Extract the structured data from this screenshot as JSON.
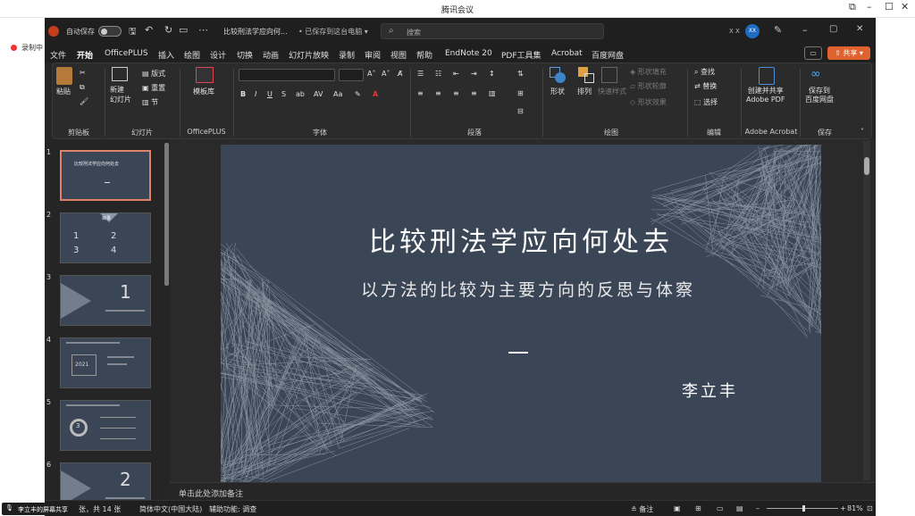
{
  "meeting": {
    "title": "腾讯会议",
    "recording": "录制中",
    "sharing": "李立丰的屏幕共享"
  },
  "ppt": {
    "autosave": "自动保存",
    "filename": "比较刑法学应向何...",
    "saved_state": "• 已保存到这台电脑 ▾",
    "search_placeholder": "搜索",
    "user_short": "X X",
    "avatar": "XX",
    "share_label": "共享",
    "menu": [
      "文件",
      "开始",
      "OfficePLUS",
      "插入",
      "绘图",
      "设计",
      "切换",
      "动画",
      "幻灯片放映",
      "录制",
      "审阅",
      "视图",
      "帮助",
      "EndNote 20",
      "PDF工具集",
      "Acrobat",
      "百度网盘"
    ],
    "active_menu": "开始",
    "ribbon": {
      "groups": [
        "剪贴板",
        "幻灯片",
        "OfficePLUS",
        "字体",
        "段落",
        "绘图",
        "编辑",
        "Adobe Acrobat",
        "保存"
      ],
      "paste": "粘贴",
      "new_slide": "新建\n幻灯片",
      "layout": "版式",
      "reset": "重置",
      "section": "节",
      "template": "模板库",
      "shape": "形状",
      "arrange": "排列",
      "quick_style": "快速样式",
      "shape_fill": "形状填充",
      "shape_outline": "形状轮廓",
      "shape_effect": "形状效果",
      "find": "查找",
      "replace": "替换",
      "select": "选择",
      "create_pdf": "创建并共享\nAdobe PDF",
      "save_baidu": "保存到\n百度网盘"
    },
    "slide": {
      "title": "比较刑法学应向何处去",
      "subtitle": "以方法的比较为主要方向的反思与体察",
      "author": "李立丰"
    },
    "thumbs": [
      {
        "num": "1",
        "label": "比较刑法学应向何处去"
      },
      {
        "num": "2",
        "label": "目录"
      },
      {
        "num": "3",
        "label": "1"
      },
      {
        "num": "4",
        "label": "2021"
      },
      {
        "num": "5",
        "label": "3"
      },
      {
        "num": "6",
        "label": "2"
      }
    ],
    "notes_placeholder": "单击此处添加备注",
    "status": {
      "slide_count": "张，共 14 张",
      "language": "简体中文(中国大陆)",
      "accessibility": "辅助功能: 调查",
      "notes": "备注",
      "zoom": "81%"
    }
  }
}
